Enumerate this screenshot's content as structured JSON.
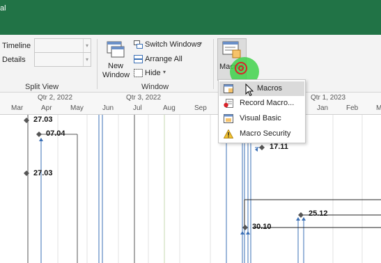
{
  "title_bar": {
    "text": "al"
  },
  "ribbon": {
    "split_view": {
      "timeline_label": "Timeline",
      "details_label": "Details",
      "group_label": "Split View"
    },
    "window": {
      "new_window_line1": "New",
      "new_window_line2": "Window",
      "switch_windows": "Switch Windows",
      "arrange_all": "Arrange All",
      "hide": "Hide",
      "group_label": "Window"
    },
    "macros": {
      "button_label": "Macros"
    }
  },
  "macros_menu": {
    "items": [
      {
        "label": "Macros",
        "icon": "macros-list-icon"
      },
      {
        "label": "Record Macro...",
        "icon": "record-macro-icon"
      },
      {
        "label": "Visual Basic",
        "icon": "visual-basic-icon"
      },
      {
        "label": "Macro Security",
        "icon": "warning-icon"
      }
    ]
  },
  "timescale": {
    "quarters": [
      "Qtr 2, 2022",
      "Qtr 3, 2022",
      "Qtr 1, 2023"
    ],
    "months": [
      "Mar",
      "Apr",
      "May",
      "Jun",
      "Jul",
      "Aug",
      "Sep",
      "Jan",
      "Feb",
      "M"
    ]
  },
  "milestones": [
    "27.03",
    "07.04",
    "27.03",
    "17.11",
    "25.12",
    "30.10"
  ],
  "colors": {
    "title_bar": "#217346",
    "task_line": "#3a6fb5",
    "cursor_highlight": "#3fd14a",
    "click_ring": "#d8232a"
  }
}
